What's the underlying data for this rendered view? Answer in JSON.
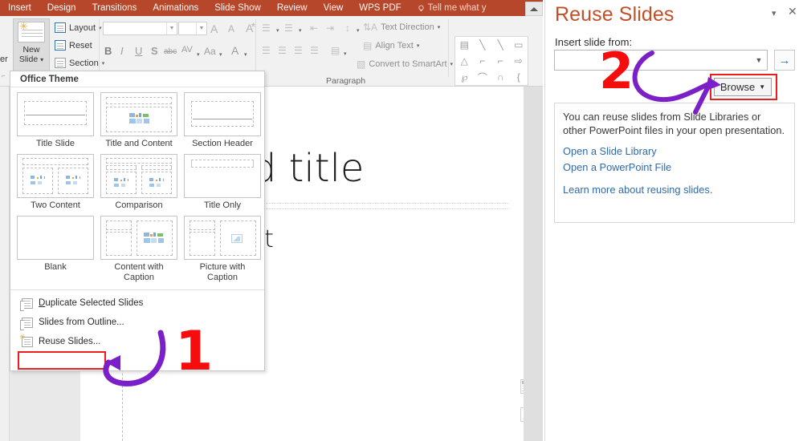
{
  "ribbon": {
    "tabs": [
      {
        "label": "Insert"
      },
      {
        "label": "Design"
      },
      {
        "label": "Transitions"
      },
      {
        "label": "Animations"
      },
      {
        "label": "Slide Show"
      },
      {
        "label": "Review"
      },
      {
        "label": "View"
      },
      {
        "label": "WPS PDF"
      }
    ],
    "tell_me": "Tell me what y",
    "left_cut_label": "er",
    "new_slide": {
      "line1": "New",
      "line2": "Slide"
    },
    "slides_group": [
      {
        "label": "Layout",
        "icon": "layout-icon",
        "has_caret": true
      },
      {
        "label": "Reset",
        "icon": "reset-icon",
        "has_caret": false
      },
      {
        "label": "Section",
        "icon": "section-icon",
        "has_caret": true
      }
    ],
    "font_group": {
      "font_name_value": "",
      "font_size_value": "",
      "grow_font": "A",
      "shrink_font": "A",
      "clear_formatting": "clear-format-icon",
      "bold": "B",
      "italic": "I",
      "underline": "U",
      "shadow": "S",
      "strikethrough": "abc",
      "char_spacing": "AV",
      "change_case": "Aa",
      "font_color": "A"
    },
    "paragraph_group": {
      "label": "Paragraph",
      "text_direction": "Text Direction",
      "align_text": "Align Text",
      "convert_smartart": "Convert to SmartArt"
    },
    "drawing_shapes": [
      "textbox",
      "line",
      "arrow",
      "rectangle",
      "triangle",
      "elbow-connector",
      "elbow-arrow-connector",
      "block-arrow",
      "scribble",
      "curve",
      "arc",
      "brace"
    ],
    "collapse_ribbon": "collapse-ribbon-icon"
  },
  "gallery": {
    "header": "Office Theme",
    "layouts": [
      {
        "name": "Title Slide",
        "kind": "title"
      },
      {
        "name": "Title and Content",
        "kind": "title-content"
      },
      {
        "name": "Section Header",
        "kind": "section"
      },
      {
        "name": "Two Content",
        "kind": "two-content"
      },
      {
        "name": "Comparison",
        "kind": "comparison"
      },
      {
        "name": "Title Only",
        "kind": "title-only"
      },
      {
        "name": "Blank",
        "kind": "blank"
      },
      {
        "name": "Content with Caption",
        "kind": "content-caption"
      },
      {
        "name": "Picture with Caption",
        "kind": "picture-caption"
      }
    ],
    "menu": [
      {
        "label": "Duplicate Selected Slides",
        "icon": "duplicate-slides-icon",
        "highlighted": false
      },
      {
        "label": "Slides from Outline...",
        "icon": "slides-from-outline-icon",
        "highlighted": false
      },
      {
        "label": "Reuse Slides...",
        "icon": "reuse-slides-icon",
        "highlighted": true
      }
    ]
  },
  "slide": {
    "title_placeholder": "add title",
    "body_placeholder": "dd text"
  },
  "panel": {
    "title": "Reuse Slides",
    "minimize_icon": "chevron-down-icon",
    "close_icon": "close-icon",
    "subtitle": "Insert slide from:",
    "combo_value": "",
    "combo_caret": "▼",
    "go_label": "→",
    "browse_label": "Browse",
    "browse_caret": "▼",
    "info_text": "You can reuse slides from Slide Libraries or other PowerPoint files in your open presentation.",
    "links": [
      {
        "label": "Open a Slide Library"
      },
      {
        "label": "Open a PowerPoint File"
      },
      {
        "label": "Learn more about reusing slides."
      }
    ]
  },
  "annotations": {
    "step_one": "1",
    "step_two": "2",
    "marker_color": "#f50d0d",
    "arrow_color": "#7b1fc9",
    "highlight_color": "#ef1c1c"
  }
}
